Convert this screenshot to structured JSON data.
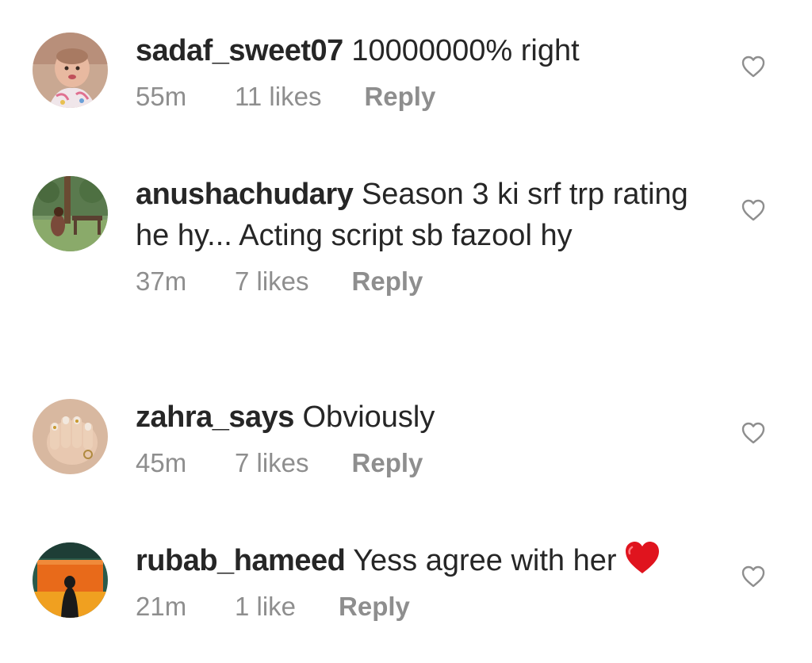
{
  "comments": [
    {
      "username": "sadaf_sweet07",
      "text": "10000000% right",
      "time": "55m",
      "likes": "11 likes",
      "reply_label": "Reply",
      "avatar_icon": "avatar-baby-photo",
      "like_icon": "heart-outline-icon"
    },
    {
      "username": "anushachudary",
      "text": "Season 3 ki srf trp rating he hy... Acting script sb fazool hy",
      "time": "37m",
      "likes": "7 likes",
      "reply_label": "Reply",
      "avatar_icon": "avatar-garden-swing-photo",
      "like_icon": "heart-outline-icon"
    },
    {
      "username": "zahra_says",
      "text": "Obviously",
      "time": "45m",
      "likes": "7 likes",
      "reply_label": "Reply",
      "avatar_icon": "avatar-hand-nails-photo",
      "like_icon": "heart-outline-icon"
    },
    {
      "username": "rubab_hameed",
      "text": "Yess agree with her",
      "emoji": "red-heart-emoji",
      "time": "21m",
      "likes": "1 like",
      "reply_label": "Reply",
      "avatar_icon": "avatar-orange-figure-photo",
      "like_icon": "heart-outline-icon"
    }
  ],
  "colors": {
    "text": "#262626",
    "meta": "#8e8e8e",
    "heart_outline": "#8e8e8e",
    "heart_emoji": "#e0141e"
  }
}
